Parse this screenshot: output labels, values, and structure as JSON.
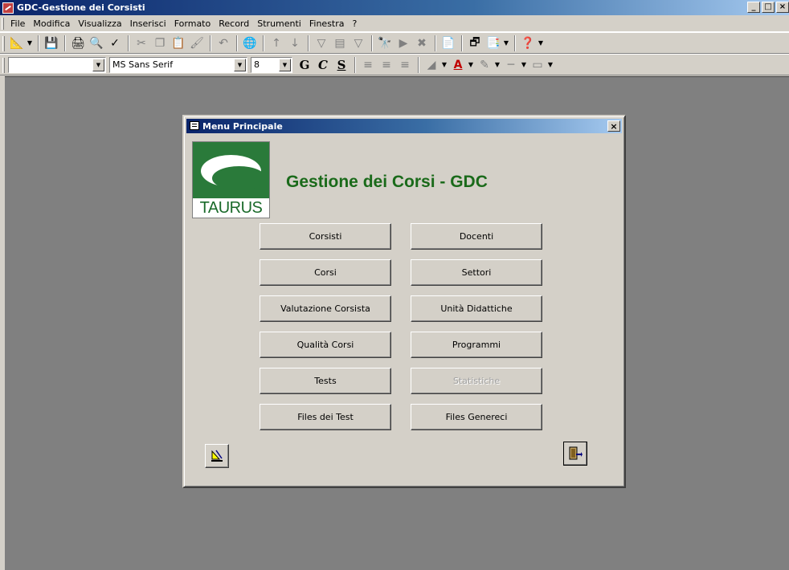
{
  "window": {
    "title": "GDC-Gestione dei Corsisti",
    "controls": [
      "_",
      "□",
      "×"
    ]
  },
  "menubar": {
    "items": [
      {
        "label": "File"
      },
      {
        "label": "Modifica"
      },
      {
        "label": "Visualizza"
      },
      {
        "label": "Inserisci"
      },
      {
        "label": "Formato"
      },
      {
        "label": "Record"
      },
      {
        "label": "Strumenti"
      },
      {
        "label": "Finestra"
      },
      {
        "label": "?"
      }
    ]
  },
  "toolbar_format": {
    "object_combo": "",
    "font_name": "MS Sans Serif",
    "font_size": "8",
    "bold": "G",
    "italic": "C",
    "underline": "S"
  },
  "dialog": {
    "title": "Menu Principale",
    "close": "×",
    "logo_text": "TAURUS",
    "headline": "Gestione dei Corsi - GDC",
    "buttons": {
      "corsisti": "Corsisti",
      "docenti": "Docenti",
      "corsi": "Corsi",
      "settori": "Settori",
      "valutazione": "Valutazione Corsista",
      "unita": "Unità Didattiche",
      "qualita": "Qualità Corsi",
      "programmi": "Programmi",
      "tests": "Tests",
      "statistiche": "Statistiche",
      "files_test": "Files dei Test",
      "files_generici": "Files Genereci"
    }
  },
  "colors": {
    "headline": "#1a6a1a",
    "logo_green": "#2a7a3a",
    "title_gradient_start": "#0a246a"
  }
}
